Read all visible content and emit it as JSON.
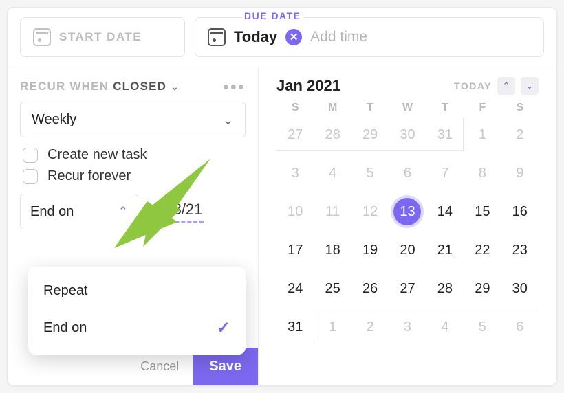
{
  "header": {
    "start_date_label": "START DATE",
    "due_date_label": "DUE DATE",
    "due_value": "Today",
    "add_time": "Add time"
  },
  "recur": {
    "label_prefix": "RECUR WHEN",
    "label_state": "CLOSED",
    "frequency": "Weekly",
    "create_new_task": "Create new task",
    "recur_forever": "Recur forever",
    "end_mode_label": "End on",
    "end_date": "1/13/21"
  },
  "dropdown": {
    "repeat": "Repeat",
    "end_on": "End on"
  },
  "footer": {
    "cancel": "Cancel",
    "save": "Save"
  },
  "calendar": {
    "month_label": "Jan 2021",
    "today_label": "TODAY",
    "dow": [
      "S",
      "M",
      "T",
      "W",
      "T",
      "F",
      "S"
    ],
    "selected_day": 13,
    "prev_tail": [
      27,
      28,
      29,
      30,
      31
    ],
    "days": [
      1,
      2,
      3,
      4,
      5,
      6,
      7,
      8,
      9,
      10,
      11,
      12,
      13,
      14,
      15,
      16,
      17,
      18,
      19,
      20,
      21,
      22,
      23,
      24,
      25,
      26,
      27,
      28,
      29,
      30,
      31
    ],
    "next_head": [
      1,
      2,
      3,
      4,
      5,
      6
    ]
  }
}
